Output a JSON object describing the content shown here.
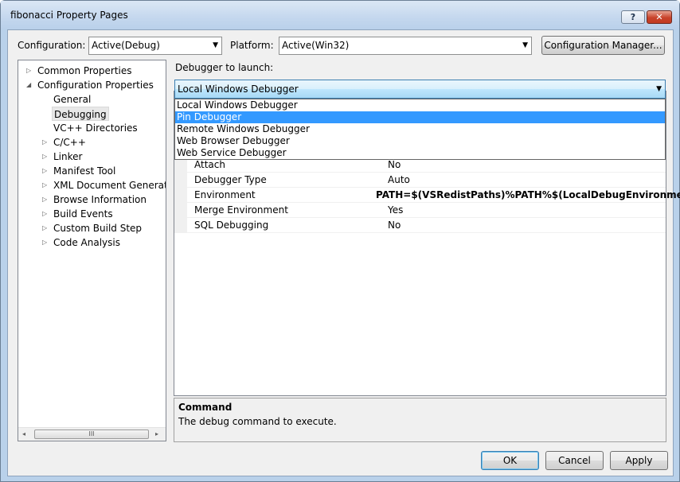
{
  "window": {
    "title": "fibonacci Property Pages",
    "help_label": "?",
    "close_label": "✕"
  },
  "config_bar": {
    "configuration_label": "Configuration:",
    "configuration_value": "Active(Debug)",
    "platform_label": "Platform:",
    "platform_value": "Active(Win32)",
    "config_manager_label": "Configuration Manager..."
  },
  "tree": {
    "items": [
      {
        "label": "Common Properties",
        "expander": "▷"
      },
      {
        "label": "Configuration Properties",
        "expander": "◢"
      },
      {
        "label": "General"
      },
      {
        "label": "Debugging"
      },
      {
        "label": "VC++ Directories"
      },
      {
        "label": "C/C++",
        "expander": "▷"
      },
      {
        "label": "Linker",
        "expander": "▷"
      },
      {
        "label": "Manifest Tool",
        "expander": "▷"
      },
      {
        "label": "XML Document Generator",
        "expander": "▷"
      },
      {
        "label": "Browse Information",
        "expander": "▷"
      },
      {
        "label": "Build Events",
        "expander": "▷"
      },
      {
        "label": "Custom Build Step",
        "expander": "▷"
      },
      {
        "label": "Code Analysis",
        "expander": "▷"
      }
    ],
    "scroll_left": "◂",
    "scroll_right": "▸",
    "scroll_grip": "III"
  },
  "debugger": {
    "launch_label": "Debugger to launch:",
    "selected": "Local Windows Debugger",
    "options": [
      "Local Windows Debugger",
      "Pin Debugger",
      "Remote Windows Debugger",
      "Web Browser Debugger",
      "Web Service Debugger"
    ],
    "highlighted_option": "Pin Debugger"
  },
  "properties": [
    {
      "name": "Attach",
      "value": "No"
    },
    {
      "name": "Debugger Type",
      "value": "Auto"
    },
    {
      "name": "Environment",
      "value": "PATH=$(VSRedistPaths)%PATH%$(LocalDebugEnvironment)"
    },
    {
      "name": "Merge Environment",
      "value": "Yes"
    },
    {
      "name": "SQL Debugging",
      "value": "No"
    }
  ],
  "description": {
    "title": "Command",
    "text": "The debug command to execute."
  },
  "buttons": {
    "ok": "OK",
    "cancel": "Cancel",
    "apply": "Apply"
  }
}
